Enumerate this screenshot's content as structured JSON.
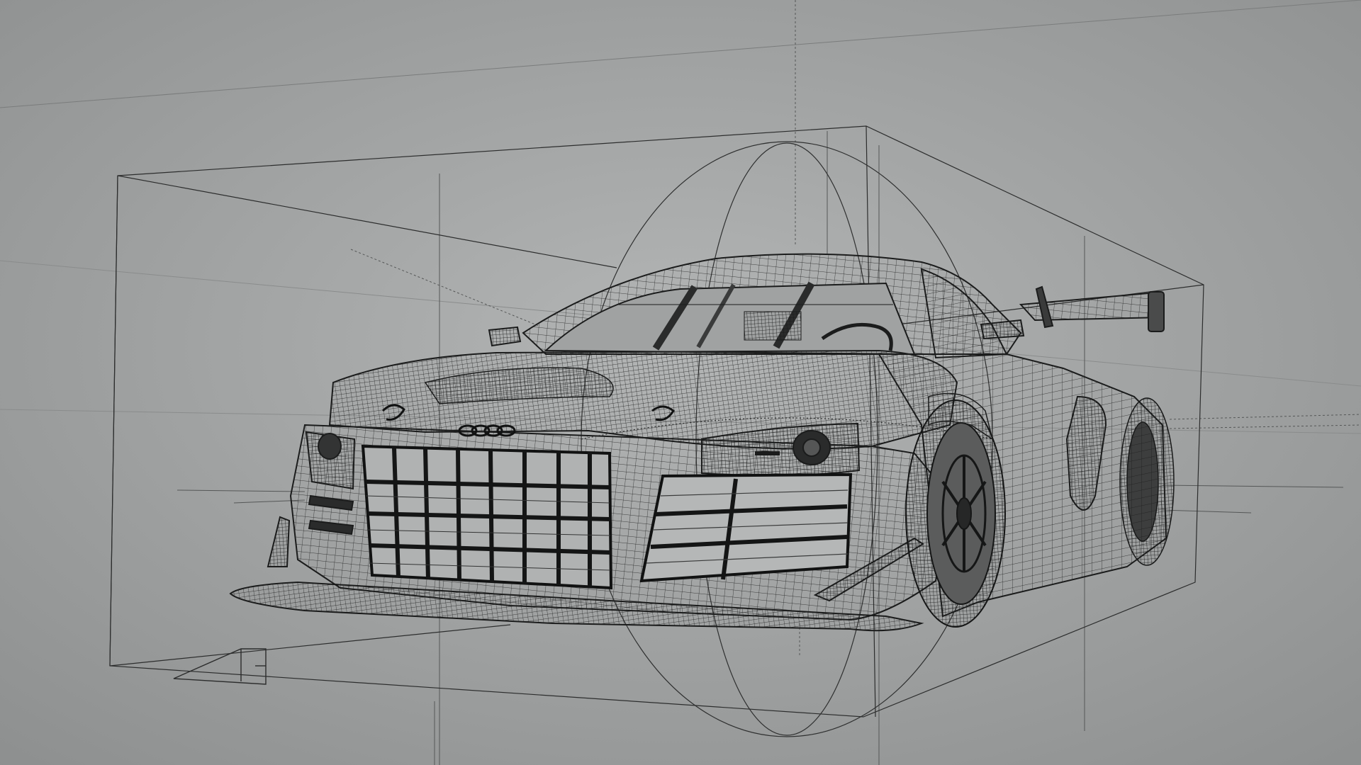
{
  "scene": {
    "subject": "car",
    "render_style": "wireframe",
    "colors": {
      "background_center": "#a9abab",
      "background_edge": "#8d8f8f",
      "wire": "#1b1c1c",
      "guide": "#333434",
      "highlight": "#c8cacb"
    },
    "overlays": [
      "bounding-box",
      "rotation-gizmo",
      "reference-lines",
      "camera-icon"
    ]
  }
}
